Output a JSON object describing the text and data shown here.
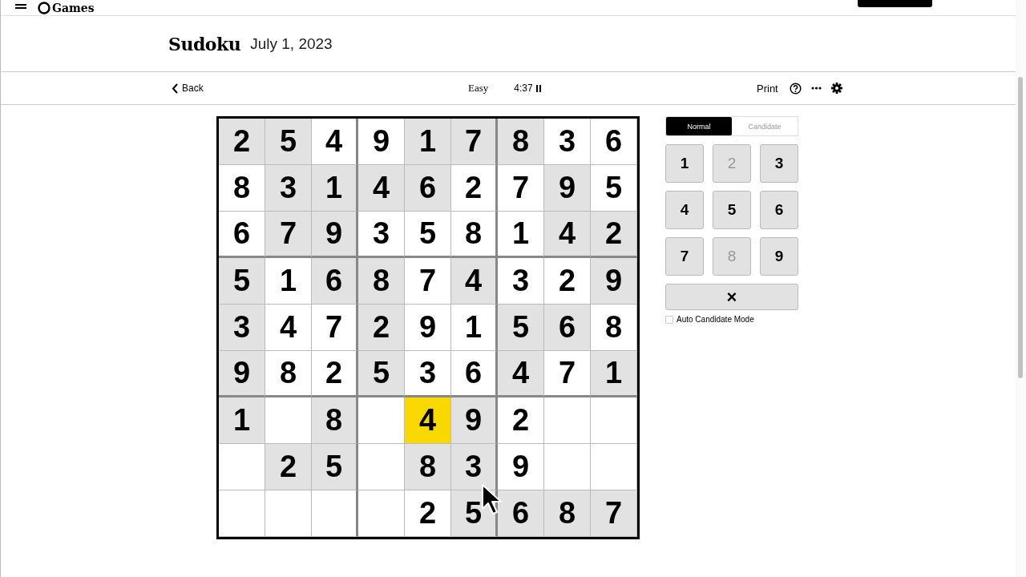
{
  "header": {
    "logo": "Games"
  },
  "title": {
    "name": "Sudoku",
    "date": "July 1, 2023"
  },
  "toolbar": {
    "back": "Back",
    "difficulty": "Easy",
    "timer": "4:37",
    "print": "Print"
  },
  "grid": [
    [
      {
        "value": "2",
        "given": true,
        "selected": false
      },
      {
        "value": "5",
        "given": true,
        "selected": false
      },
      {
        "value": "4",
        "given": false,
        "selected": false
      },
      {
        "value": "9",
        "given": false,
        "selected": false
      },
      {
        "value": "1",
        "given": true,
        "selected": false
      },
      {
        "value": "7",
        "given": true,
        "selected": false
      },
      {
        "value": "8",
        "given": true,
        "selected": false
      },
      {
        "value": "3",
        "given": false,
        "selected": false
      },
      {
        "value": "6",
        "given": false,
        "selected": false
      }
    ],
    [
      {
        "value": "8",
        "given": false,
        "selected": false
      },
      {
        "value": "3",
        "given": true,
        "selected": false
      },
      {
        "value": "1",
        "given": true,
        "selected": false
      },
      {
        "value": "4",
        "given": true,
        "selected": false
      },
      {
        "value": "6",
        "given": true,
        "selected": false
      },
      {
        "value": "2",
        "given": false,
        "selected": false
      },
      {
        "value": "7",
        "given": false,
        "selected": false
      },
      {
        "value": "9",
        "given": true,
        "selected": false
      },
      {
        "value": "5",
        "given": false,
        "selected": false
      }
    ],
    [
      {
        "value": "6",
        "given": false,
        "selected": false
      },
      {
        "value": "7",
        "given": true,
        "selected": false
      },
      {
        "value": "9",
        "given": true,
        "selected": false
      },
      {
        "value": "3",
        "given": false,
        "selected": false
      },
      {
        "value": "5",
        "given": false,
        "selected": false
      },
      {
        "value": "8",
        "given": false,
        "selected": false
      },
      {
        "value": "1",
        "given": false,
        "selected": false
      },
      {
        "value": "4",
        "given": true,
        "selected": false
      },
      {
        "value": "2",
        "given": true,
        "selected": false
      }
    ],
    [
      {
        "value": "5",
        "given": true,
        "selected": false
      },
      {
        "value": "1",
        "given": false,
        "selected": false
      },
      {
        "value": "6",
        "given": true,
        "selected": false
      },
      {
        "value": "8",
        "given": true,
        "selected": false
      },
      {
        "value": "7",
        "given": false,
        "selected": false
      },
      {
        "value": "4",
        "given": true,
        "selected": false
      },
      {
        "value": "3",
        "given": false,
        "selected": false
      },
      {
        "value": "2",
        "given": false,
        "selected": false
      },
      {
        "value": "9",
        "given": true,
        "selected": false
      }
    ],
    [
      {
        "value": "3",
        "given": true,
        "selected": false
      },
      {
        "value": "4",
        "given": false,
        "selected": false
      },
      {
        "value": "7",
        "given": false,
        "selected": false
      },
      {
        "value": "2",
        "given": true,
        "selected": false
      },
      {
        "value": "9",
        "given": false,
        "selected": false
      },
      {
        "value": "1",
        "given": false,
        "selected": false
      },
      {
        "value": "5",
        "given": true,
        "selected": false
      },
      {
        "value": "6",
        "given": true,
        "selected": false
      },
      {
        "value": "8",
        "given": false,
        "selected": false
      }
    ],
    [
      {
        "value": "9",
        "given": true,
        "selected": false
      },
      {
        "value": "8",
        "given": false,
        "selected": false
      },
      {
        "value": "2",
        "given": false,
        "selected": false
      },
      {
        "value": "5",
        "given": true,
        "selected": false
      },
      {
        "value": "3",
        "given": false,
        "selected": false
      },
      {
        "value": "6",
        "given": false,
        "selected": false
      },
      {
        "value": "4",
        "given": true,
        "selected": false
      },
      {
        "value": "7",
        "given": false,
        "selected": false
      },
      {
        "value": "1",
        "given": true,
        "selected": false
      }
    ],
    [
      {
        "value": "1",
        "given": true,
        "selected": false
      },
      {
        "given": false,
        "selected": false
      },
      {
        "value": "8",
        "given": true,
        "selected": false
      },
      {
        "given": false,
        "selected": false
      },
      {
        "value": "4",
        "selected": true
      },
      {
        "value": "9",
        "given": true,
        "selected": false
      },
      {
        "value": "2",
        "given": false,
        "selected": false
      },
      {
        "given": false,
        "selected": false
      },
      {
        "given": false,
        "selected": false
      }
    ],
    [
      {
        "given": false,
        "selected": false
      },
      {
        "value": "2",
        "given": true,
        "selected": false
      },
      {
        "value": "5",
        "given": true,
        "selected": false
      },
      {
        "given": false,
        "selected": false
      },
      {
        "value": "8",
        "given": true,
        "selected": false
      },
      {
        "value": "3",
        "given": true,
        "selected": false
      },
      {
        "value": "9",
        "given": false,
        "selected": false
      },
      {
        "given": false,
        "selected": false
      },
      {
        "given": false,
        "selected": false
      }
    ],
    [
      {
        "given": false,
        "selected": false
      },
      {
        "given": false,
        "selected": false
      },
      {
        "given": false,
        "selected": false
      },
      {
        "given": false,
        "selected": false
      },
      {
        "value": "2",
        "given": false,
        "selected": false
      },
      {
        "value": "5",
        "given": true,
        "selected": false
      },
      {
        "value": "6",
        "given": true,
        "selected": false
      },
      {
        "value": "8",
        "given": true,
        "selected": false
      },
      {
        "value": "7",
        "given": true,
        "selected": false
      }
    ]
  ],
  "modes": [
    {
      "label": "Normal",
      "selected": true
    },
    {
      "label": "Candidate",
      "selected": false
    }
  ],
  "keypad": [
    {
      "label": "1",
      "disabled": false
    },
    {
      "label": "2",
      "disabled": true
    },
    {
      "label": "3",
      "disabled": false
    },
    {
      "label": "4",
      "disabled": false
    },
    {
      "label": "5",
      "disabled": false
    },
    {
      "label": "6",
      "disabled": false
    },
    {
      "label": "7",
      "disabled": false
    },
    {
      "label": "8",
      "disabled": true
    },
    {
      "label": "9",
      "disabled": false
    }
  ],
  "clear": {
    "label": "×"
  },
  "auto_candidate": {
    "label": "Auto Candidate Mode",
    "checked": false
  }
}
